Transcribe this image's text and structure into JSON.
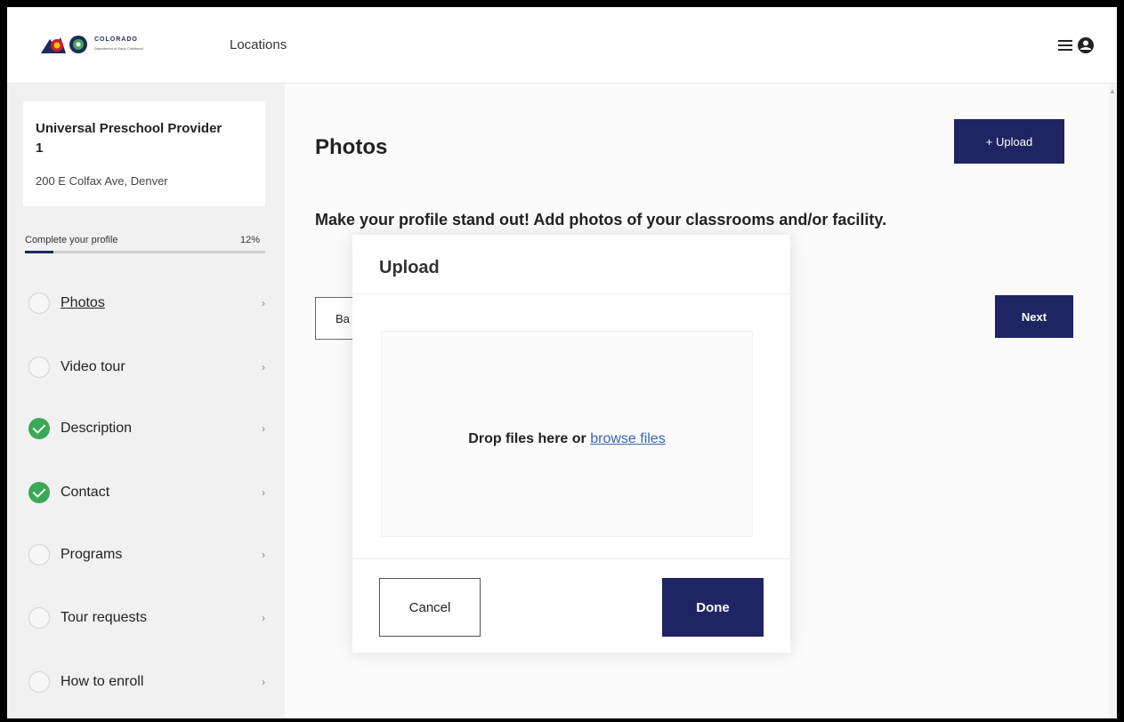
{
  "header": {
    "logo": {
      "state": "COLORADO",
      "department": "Department of Early Childhood"
    },
    "nav_locations": "Locations",
    "menu_icon": "menu-icon",
    "account_icon": "account-icon"
  },
  "sidebar": {
    "provider": {
      "name": "Universal Preschool Provider 1",
      "address": "200 E Colfax Ave, Denver"
    },
    "progress": {
      "label": "Complete your profile",
      "percent_text": "12%",
      "percent": 12
    },
    "items": [
      {
        "label": "Photos",
        "status": "incomplete",
        "current": true
      },
      {
        "label": "Video tour",
        "status": "incomplete"
      },
      {
        "label": "Description",
        "status": "complete"
      },
      {
        "label": "Contact",
        "status": "complete"
      },
      {
        "label": "Programs",
        "status": "incomplete"
      },
      {
        "label": "Tour requests",
        "status": "incomplete"
      },
      {
        "label": "How to enroll",
        "status": "incomplete"
      }
    ],
    "chevron": "›"
  },
  "main": {
    "title": "Photos",
    "upload_label": "+ Upload",
    "lead": "Make your profile stand out! Add photos of your classrooms and/or facility.",
    "back_label": "Ba",
    "next_label": "Next"
  },
  "modal": {
    "title": "Upload",
    "drop_text": "Drop files here or",
    "browse_text": "browse files",
    "cancel_label": "Cancel",
    "done_label": "Done"
  },
  "colors": {
    "primary": "#1e2562",
    "success": "#3aa856",
    "link": "#3865b8"
  }
}
